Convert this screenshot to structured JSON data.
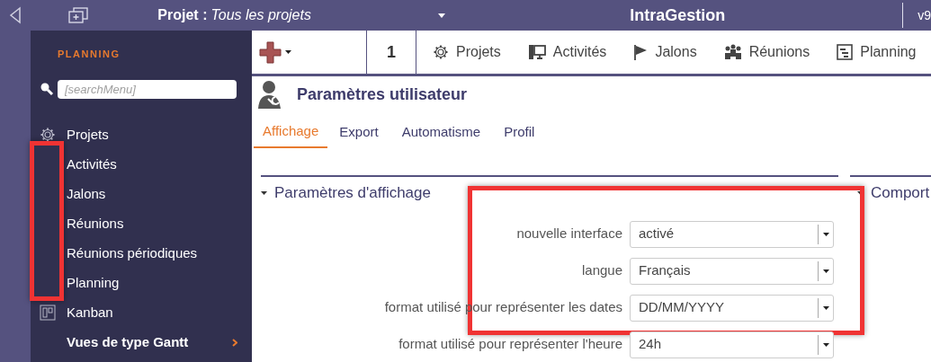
{
  "header": {
    "project_label": "Projet :",
    "project_value": "Tous les projets",
    "app_title": "IntraGestion",
    "version": "v9"
  },
  "sidebar": {
    "section": "PLANNING",
    "search": {
      "placeholder": "[searchMenu]"
    },
    "items": [
      {
        "label": "Projets",
        "kind": "gear"
      },
      {
        "label": "Activités",
        "kind": "item"
      },
      {
        "label": "Jalons",
        "kind": "item"
      },
      {
        "label": "Réunions",
        "kind": "item"
      },
      {
        "label": "Réunions périodiques",
        "kind": "item"
      },
      {
        "label": "Planning",
        "kind": "item"
      },
      {
        "label": "Kanban",
        "kind": "kanban"
      },
      {
        "label": "Vues de type Gantt",
        "kind": "group"
      }
    ]
  },
  "toolbar": {
    "counter": "1",
    "shortcuts": [
      {
        "label": "Projets",
        "kind": "gear"
      },
      {
        "label": "Activités",
        "kind": "monitor"
      },
      {
        "label": "Jalons",
        "kind": "flag"
      },
      {
        "label": "Réunions",
        "kind": "people"
      },
      {
        "label": "Planning",
        "kind": "planning"
      }
    ]
  },
  "page": {
    "title": "Paramètres utilisateur",
    "tabs": [
      {
        "label": "Affichage",
        "selected": true
      },
      {
        "label": "Export",
        "selected": false
      },
      {
        "label": "Automatisme",
        "selected": false
      },
      {
        "label": "Profil",
        "selected": false
      }
    ],
    "sections": [
      {
        "title": "Paramètres d'affichage",
        "fields": [
          {
            "label": "nouvelle interface",
            "value": "activé"
          },
          {
            "label": "langue",
            "value": "Français"
          },
          {
            "label": "format utilisé pour représenter les dates",
            "value": "DD/MM/YYYY"
          },
          {
            "label": "format utilisé pour représenter l'heure",
            "value": "24h"
          }
        ]
      },
      {
        "title": "Comport"
      }
    ]
  }
}
